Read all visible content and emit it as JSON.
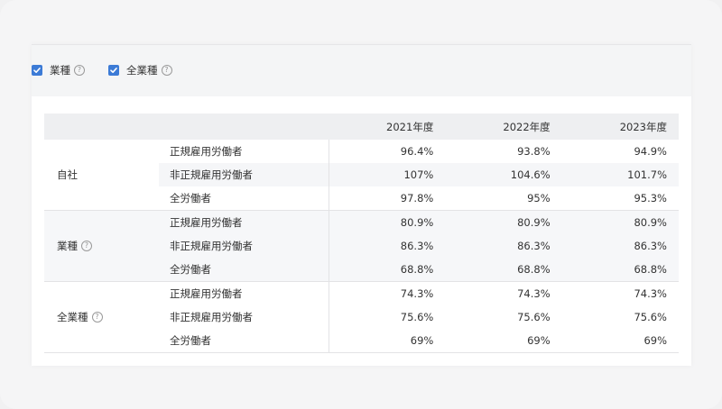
{
  "filters": [
    {
      "label": "業種",
      "checked": true,
      "help": true
    },
    {
      "label": "全業種",
      "checked": true,
      "help": true
    }
  ],
  "table": {
    "headers": [
      "",
      "",
      "2021年度",
      "2022年度",
      "2023年度"
    ],
    "groups": [
      {
        "label": "自社",
        "rows": [
          {
            "label": "正規雇用労働者",
            "values": [
              "96.4%",
              "93.8%",
              "94.9%"
            ]
          },
          {
            "label": "非正規雇用労働者",
            "values": [
              "107%",
              "104.6%",
              "101.7%"
            ]
          },
          {
            "label": "全労働者",
            "values": [
              "97.8%",
              "95%",
              "95.3%"
            ]
          }
        ]
      },
      {
        "label": "業種",
        "rows": [
          {
            "label": "正規雇用労働者",
            "values": [
              "80.9%",
              "80.9%",
              "80.9%"
            ]
          },
          {
            "label": "非正規雇用労働者",
            "values": [
              "86.3%",
              "86.3%",
              "86.3%"
            ]
          },
          {
            "label": "全労働者",
            "values": [
              "68.8%",
              "68.8%",
              "68.8%"
            ]
          }
        ]
      },
      {
        "label": "全業種",
        "rows": [
          {
            "label": "正規雇用労働者",
            "values": [
              "74.3%",
              "74.3%",
              "74.3%"
            ]
          },
          {
            "label": "非正規雇用労働者",
            "values": [
              "75.6%",
              "75.6%",
              "75.6%"
            ]
          },
          {
            "label": "全労働者",
            "values": [
              "69%",
              "69%",
              "69%"
            ]
          }
        ]
      }
    ]
  },
  "colors": {
    "accent": "#3c7bd6",
    "header_bg": "#eeeff1",
    "row_shade": "#f5f6f8"
  },
  "icons": {
    "help": "help-circle-icon",
    "check": "checkmark-icon"
  },
  "help_glyph": "?"
}
